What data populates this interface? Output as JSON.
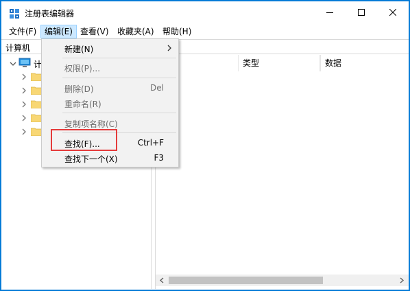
{
  "window": {
    "title": "注册表编辑器"
  },
  "menubar": {
    "items": [
      {
        "label": "文件(F)"
      },
      {
        "label": "编辑(E)"
      },
      {
        "label": "查看(V)"
      },
      {
        "label": "收藏夹(A)"
      },
      {
        "label": "帮助(H)"
      }
    ]
  },
  "address": {
    "path": "计算机"
  },
  "tree": {
    "root_label": "计",
    "child_count": 5
  },
  "list": {
    "columns": [
      {
        "label": ""
      },
      {
        "label": "类型"
      },
      {
        "label": "数据"
      }
    ]
  },
  "edit_menu": {
    "items": [
      {
        "label": "新建(N)",
        "shortcut": "",
        "enabled": true,
        "submenu": true
      },
      {
        "label": "权限(P)...",
        "shortcut": "",
        "enabled": false
      },
      {
        "label": "删除(D)",
        "shortcut": "Del",
        "enabled": false
      },
      {
        "label": "重命名(R)",
        "shortcut": "",
        "enabled": false
      },
      {
        "label": "复制项名称(C)",
        "shortcut": "",
        "enabled": false
      },
      {
        "label": "查找(F)...",
        "shortcut": "Ctrl+F",
        "enabled": true
      },
      {
        "label": "查找下一个(X)",
        "shortcut": "F3",
        "enabled": true
      }
    ]
  },
  "colors": {
    "accent_border": "#1883d7",
    "menu_active_bg": "#cce8ff",
    "highlight_red": "#e53b3b",
    "folder_yellow": "#f8d775"
  },
  "icons": {
    "app": "registry-editor-icon",
    "computer": "computer-icon",
    "folder": "folder-icon"
  }
}
